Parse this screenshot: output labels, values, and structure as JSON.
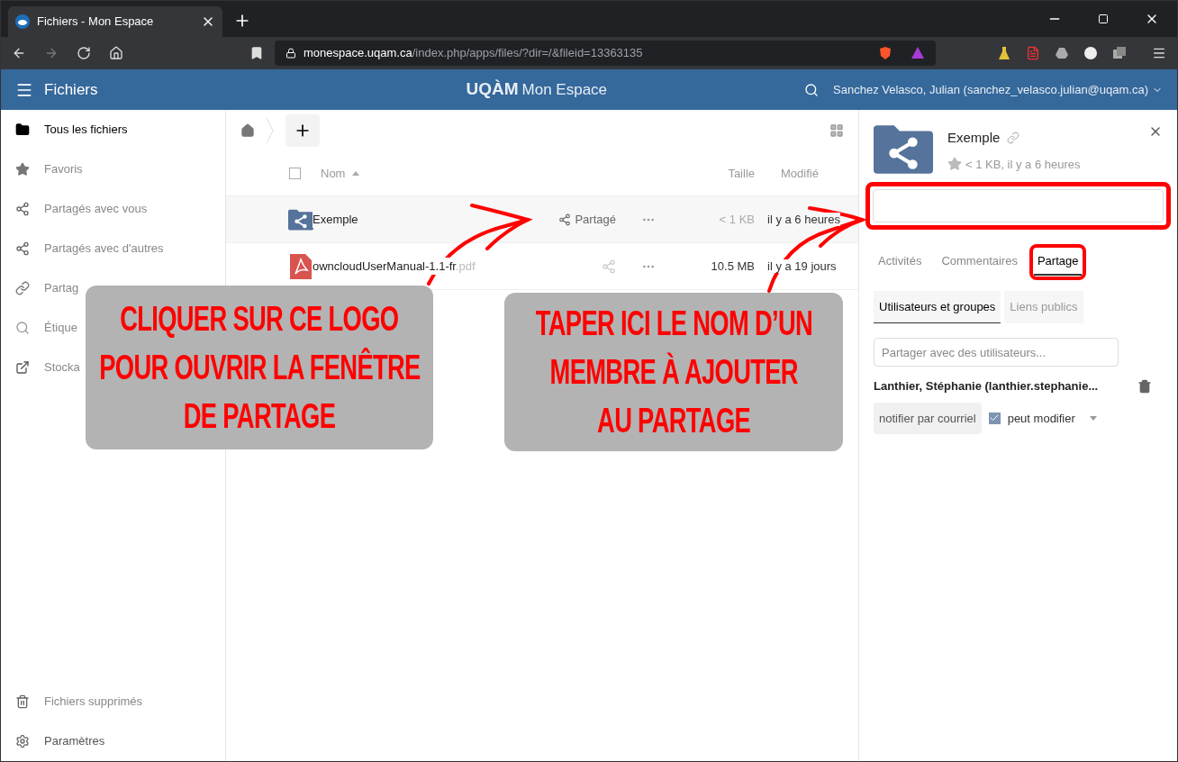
{
  "browser": {
    "tab_title": "Fichiers - Mon Espace",
    "url_host": "monespace.uqam.ca",
    "url_path": "/index.php/apps/files/?dir=/&fileid=13363135"
  },
  "header": {
    "app_title": "Fichiers",
    "brand": "UQÀM",
    "brand_sub": "Mon Espace",
    "user": "Sanchez Velasco, Julian (sanchez_velasco.julian@uqam.ca)"
  },
  "sidebar": {
    "items": [
      {
        "label": "Tous les fichiers",
        "kind": "folder",
        "selected": true
      },
      {
        "label": "Favoris",
        "kind": "star",
        "selected": false
      },
      {
        "label": "Partagés avec vous",
        "kind": "share",
        "selected": false
      },
      {
        "label": "Partagés avec d'autres",
        "kind": "share",
        "selected": false
      },
      {
        "label": "Partag",
        "kind": "link",
        "selected": false
      },
      {
        "label": "Étique",
        "kind": "search",
        "selected": false
      },
      {
        "label": "Stocka",
        "kind": "external",
        "selected": false
      }
    ],
    "bottom": [
      {
        "label": "Fichiers supprimés",
        "kind": "trash"
      },
      {
        "label": "Paramètres",
        "kind": "gear"
      }
    ]
  },
  "files": {
    "select_all_checked": false,
    "columns": {
      "name": "Nom",
      "size": "Taille",
      "modified": "Modifié"
    },
    "rows": [
      {
        "kind": "folder",
        "name": "Exemple",
        "shared_label": "Partagé",
        "size": "< 1 KB",
        "modified": "il y a 6 heures",
        "selected": true
      },
      {
        "kind": "pdf",
        "name": "owncloudUserManual-1.1-fr",
        "ext": ".pdf",
        "size": "10.5 MB",
        "modified": "il y a 19 jours",
        "selected": false
      }
    ]
  },
  "details": {
    "field_highlighted": true,
    "name": "Exemple",
    "meta": "< 1 KB, il y a 6 heures",
    "tabs": [
      {
        "label": "Activités",
        "selected": false
      },
      {
        "label": "Commentaires",
        "selected": false
      },
      {
        "label": "Partage",
        "selected": true,
        "highlighted": true
      }
    ],
    "subtabs": [
      {
        "label": "Utilisateurs et groupes",
        "selected": true
      },
      {
        "label": "Liens publics",
        "selected": false
      }
    ],
    "share_placeholder": "Partager avec des utilisateurs...",
    "share": {
      "name": "Lanthier, Stéphanie (lanthier.stephanie...",
      "notify": "notifier par courriel",
      "permission": "peut modifier",
      "checked": true
    }
  },
  "annotations": [
    {
      "lines": [
        "CLIQUER SUR CE LOGO",
        "POUR OUVRIR LA FENÊTRE",
        "DE PARTAGE"
      ]
    },
    {
      "lines": [
        "TAPER ICI LE NOM D’UN",
        "MEMBRE À AJOUTER",
        "AU PARTAGE"
      ]
    }
  ]
}
